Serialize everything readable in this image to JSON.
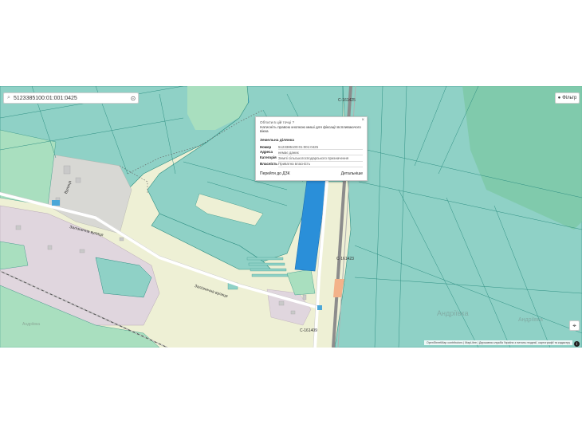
{
  "search": {
    "value": "5123385100:01:001:0425"
  },
  "filter": {
    "label": "Фільтр"
  },
  "popup": {
    "question": "Об'єкти в цій точці ?",
    "hint": "Натисніть правою кнопкою миші для фіксації вспливаючого вікна",
    "section_title": "Земельна ділянка",
    "fields": [
      {
        "key": "Номер",
        "value": "5123385100:01:001:0425"
      },
      {
        "key": "Адреса",
        "value": "немає даних"
      },
      {
        "key": "Категорія",
        "value": "Землі сільськогосподарського призначення"
      },
      {
        "key": "Власність",
        "value": "Приватна власність"
      }
    ],
    "goto_label": "Перейти до ДЗК",
    "details_label": "Детальніше"
  },
  "labels": {
    "road_c161425": "С-161425",
    "road_c161423": "С-161423",
    "road_c161409": "С-161409",
    "street_zaliznychna_1": "Залізнична вулиця",
    "street_zaliznychna_2": "Залізнична вулиця",
    "street_vertical": "Вулиця",
    "faint_place": "Андріївка",
    "faint_right": "Андріївка",
    "faint_left": "Андріївка"
  },
  "attribution": "OpenStreetMap contributors | MapLibre | Державна служба України з питань геодезії, картографії та кадастру",
  "colors": {
    "parcel": "#8fd1c6",
    "parcel_stroke": "#2f8f83",
    "green_area": "#a9dfbf",
    "farmland": "#eef0d5",
    "residential": "#e0d6de",
    "selected": "#2a8fd9",
    "road_orange": "#f3b28a",
    "water": "#4ba7d8"
  }
}
